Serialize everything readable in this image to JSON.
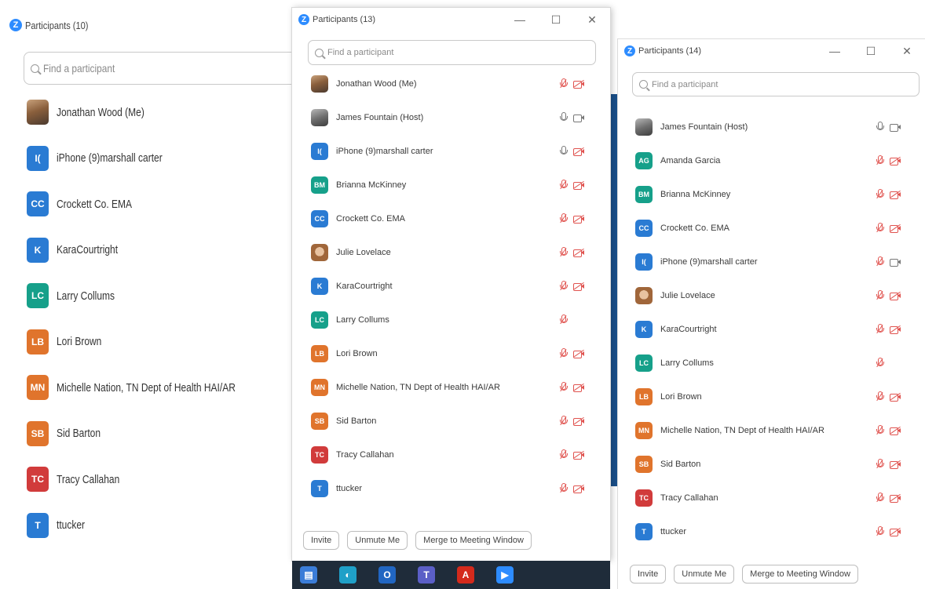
{
  "colors": {
    "muted_red": "#e0534f",
    "zoom_blue": "#2d8cff",
    "taskbar": "#1f2c3a"
  },
  "panels": [
    {
      "title": "Participants (10)",
      "search_placeholder": "Find a participant",
      "participants": [
        {
          "name": "Jonathan Wood (Me)",
          "initials": "",
          "color": "",
          "photo": true
        },
        {
          "name": "iPhone (9)marshall carter",
          "initials": "I(",
          "color": "#2a7bd3"
        },
        {
          "name": "Crockett Co. EMA",
          "initials": "CC",
          "color": "#2a7bd3"
        },
        {
          "name": "KaraCourtright",
          "initials": "K",
          "color": "#2a7bd3"
        },
        {
          "name": "Larry Collums",
          "initials": "LC",
          "color": "#16a08a"
        },
        {
          "name": "Lori Brown",
          "initials": "LB",
          "color": "#e0742c"
        },
        {
          "name": "Michelle Nation, TN Dept of Health HAI/AR",
          "initials": "MN",
          "color": "#e0742c"
        },
        {
          "name": "Sid Barton",
          "initials": "SB",
          "color": "#e0742c"
        },
        {
          "name": "Tracy Callahan",
          "initials": "TC",
          "color": "#d13b3b"
        },
        {
          "name": "ttucker",
          "initials": "T",
          "color": "#2a7bd3"
        }
      ]
    },
    {
      "title": "Participants (13)",
      "search_placeholder": "Find a participant",
      "participants": [
        {
          "name": "Jonathan Wood (Me)",
          "initials": "",
          "photo": true,
          "mic": "muted",
          "cam": "muted"
        },
        {
          "name": "James Fountain (Host)",
          "initials": "",
          "photo": true,
          "grey": true,
          "mic": "live",
          "cam": "live"
        },
        {
          "name": "iPhone (9)marshall carter",
          "initials": "I(",
          "color": "#2a7bd3",
          "mic": "live",
          "cam": "muted"
        },
        {
          "name": "Brianna McKinney",
          "initials": "BM",
          "color": "#16a08a",
          "mic": "muted",
          "cam": "muted"
        },
        {
          "name": "Crockett Co. EMA",
          "initials": "CC",
          "color": "#2a7bd3",
          "mic": "muted",
          "cam": "muted"
        },
        {
          "name": "Julie Lovelace",
          "initials": "",
          "photo": true,
          "julie": true,
          "mic": "muted",
          "cam": "muted"
        },
        {
          "name": "KaraCourtright",
          "initials": "K",
          "color": "#2a7bd3",
          "mic": "muted",
          "cam": "muted"
        },
        {
          "name": "Larry Collums",
          "initials": "LC",
          "color": "#16a08a",
          "mic": "muted",
          "cam": "none"
        },
        {
          "name": "Lori Brown",
          "initials": "LB",
          "color": "#e0742c",
          "mic": "muted",
          "cam": "muted"
        },
        {
          "name": "Michelle Nation, TN Dept of Health HAI/AR",
          "initials": "MN",
          "color": "#e0742c",
          "mic": "muted",
          "cam": "muted"
        },
        {
          "name": "Sid Barton",
          "initials": "SB",
          "color": "#e0742c",
          "mic": "muted",
          "cam": "muted"
        },
        {
          "name": "Tracy Callahan",
          "initials": "TC",
          "color": "#d13b3b",
          "mic": "muted",
          "cam": "muted"
        },
        {
          "name": "ttucker",
          "initials": "T",
          "color": "#2a7bd3",
          "mic": "muted",
          "cam": "muted"
        }
      ],
      "buttons": {
        "invite": "Invite",
        "unmute": "Unmute Me",
        "merge": "Merge to Meeting Window"
      }
    },
    {
      "title": "Participants (14)",
      "search_placeholder": "Find a participant",
      "participants": [
        {
          "name": "James Fountain (Host)",
          "initials": "",
          "photo": true,
          "grey": true,
          "mic": "live",
          "cam": "live"
        },
        {
          "name": "Amanda Garcia",
          "initials": "AG",
          "color": "#16a08a",
          "mic": "muted",
          "cam": "muted"
        },
        {
          "name": "Brianna McKinney",
          "initials": "BM",
          "color": "#16a08a",
          "mic": "muted",
          "cam": "muted"
        },
        {
          "name": "Crockett Co. EMA",
          "initials": "CC",
          "color": "#2a7bd3",
          "mic": "muted",
          "cam": "muted"
        },
        {
          "name": "iPhone (9)marshall carter",
          "initials": "I(",
          "color": "#2a7bd3",
          "mic": "muted",
          "cam": "live"
        },
        {
          "name": "Julie Lovelace",
          "initials": "",
          "photo": true,
          "julie": true,
          "mic": "muted",
          "cam": "muted"
        },
        {
          "name": "KaraCourtright",
          "initials": "K",
          "color": "#2a7bd3",
          "mic": "muted",
          "cam": "muted"
        },
        {
          "name": "Larry Collums",
          "initials": "LC",
          "color": "#16a08a",
          "mic": "muted",
          "cam": "none"
        },
        {
          "name": "Lori Brown",
          "initials": "LB",
          "color": "#e0742c",
          "mic": "muted",
          "cam": "muted"
        },
        {
          "name": "Michelle Nation, TN Dept of Health HAI/AR",
          "initials": "MN",
          "color": "#e0742c",
          "mic": "muted",
          "cam": "muted"
        },
        {
          "name": "Sid Barton",
          "initials": "SB",
          "color": "#e0742c",
          "mic": "muted",
          "cam": "muted"
        },
        {
          "name": "Tracy Callahan",
          "initials": "TC",
          "color": "#d13b3b",
          "mic": "muted",
          "cam": "muted"
        },
        {
          "name": "ttucker",
          "initials": "T",
          "color": "#2a7bd3",
          "mic": "muted",
          "cam": "muted"
        }
      ],
      "buttons": {
        "invite": "Invite",
        "unmute": "Unmute Me",
        "merge": "Merge to Meeting Window"
      }
    }
  ],
  "taskbar": {
    "icons": [
      {
        "name": "file-explorer-icon",
        "glyph": "▤",
        "color": "#3b7dd8"
      },
      {
        "name": "edge-icon",
        "glyph": "◐",
        "color": "#1fa0c8"
      },
      {
        "name": "outlook-icon",
        "glyph": "O",
        "color": "#2166c2"
      },
      {
        "name": "teams-icon",
        "glyph": "T",
        "color": "#5b5fc7"
      },
      {
        "name": "acrobat-icon",
        "glyph": "A",
        "color": "#d42a1c"
      },
      {
        "name": "zoom-icon",
        "glyph": "▶",
        "color": "#2d8cff"
      }
    ]
  }
}
